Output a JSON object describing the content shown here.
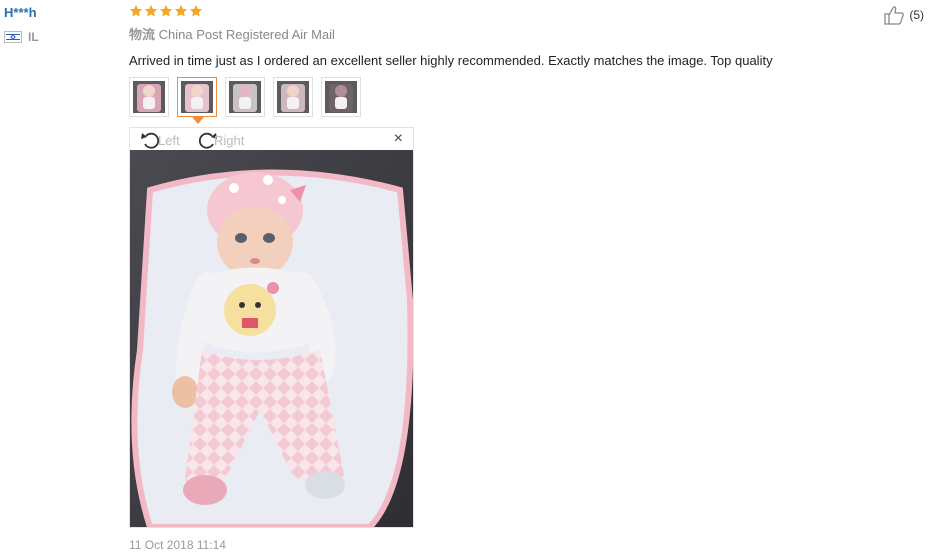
{
  "review": {
    "user_name": "H***h",
    "country": "IL",
    "rating": 5,
    "shipping_label": "物流",
    "shipping_method": "China Post Registered Air Mail",
    "text": "Arrived in time just as I ordered an excellent seller highly recommended. Exactly matches the image. Top quality",
    "helpful_count": "(5)",
    "date": "11 Oct 2018 11:14"
  },
  "viewer": {
    "rotate_left_label": "Left",
    "rotate_right_label": "Right",
    "close_label": "×"
  },
  "thumbnails": [
    {
      "name": "photo-1",
      "active": false
    },
    {
      "name": "photo-2",
      "active": true
    },
    {
      "name": "photo-3",
      "active": false
    },
    {
      "name": "photo-4",
      "active": false
    },
    {
      "name": "photo-5",
      "active": false
    }
  ],
  "icons": {
    "star": "star-icon",
    "thumbs_up": "thumbs-up-icon",
    "rotate_left": "rotate-left-icon",
    "rotate_right": "rotate-right-icon",
    "close": "close-icon",
    "flag": "flag-icon"
  },
  "colors": {
    "star": "#f5a623",
    "username": "#2a6fb0",
    "active_thumb": "#f08c3a"
  }
}
